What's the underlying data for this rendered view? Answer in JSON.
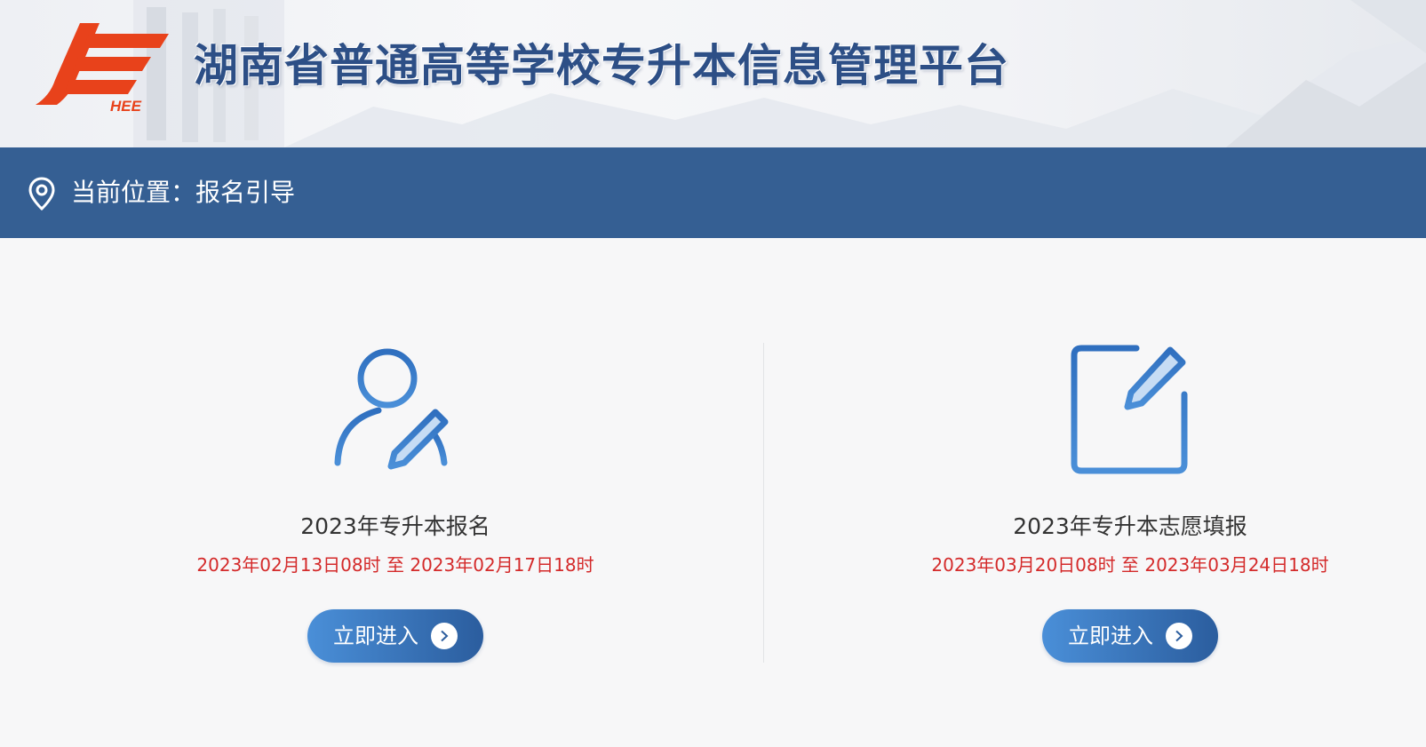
{
  "header": {
    "title": "湖南省普通高等学校专升本信息管理平台",
    "logo_text": "HEE",
    "logo_color": "#e8421b",
    "title_color": "#2d4f86"
  },
  "breadcrumb": {
    "icon": "location-pin-icon",
    "label": "当前位置：",
    "current": "报名引导",
    "bar_color": "#355f93"
  },
  "cards": [
    {
      "icon": "user-edit-icon",
      "title": "2023年专升本报名",
      "period": "2023年02月13日08时 至 2023年02月17日18时",
      "button_label": "立即进入",
      "button_icon": "chevron-right-icon"
    },
    {
      "icon": "form-edit-icon",
      "title": "2023年专升本志愿填报",
      "period": "2023年03月20日08时 至 2023年03月24日18时",
      "button_label": "立即进入",
      "button_icon": "chevron-right-icon"
    }
  ],
  "colors": {
    "accent": "#2f6fbf",
    "period_text": "#d42a2a",
    "page_bg": "#f7f7f8"
  }
}
